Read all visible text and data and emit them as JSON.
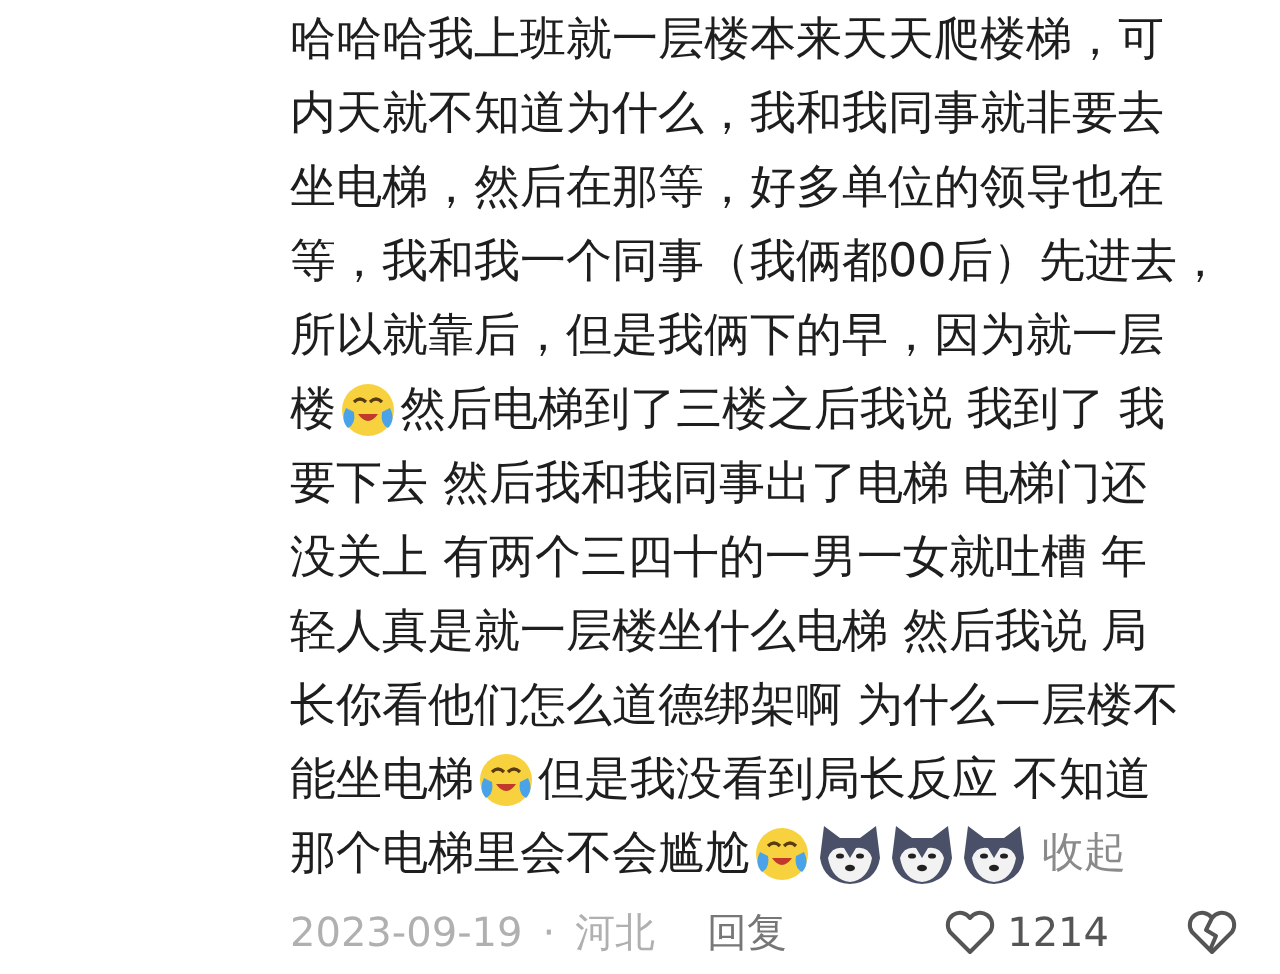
{
  "comment": {
    "lines": [
      {
        "segments": [
          {
            "kind": "text",
            "text": "哈哈哈我上班就一层楼本来天天爬楼梯，可"
          }
        ]
      },
      {
        "segments": [
          {
            "kind": "text",
            "text": "内天就不知道为什么，我和我同事就非要去"
          }
        ]
      },
      {
        "segments": [
          {
            "kind": "text",
            "text": "坐电梯，然后在那等，好多单位的领导也在"
          }
        ]
      },
      {
        "segments": [
          {
            "kind": "text",
            "text": "等，我和我一个同事（我俩都00后）先进去，"
          }
        ]
      },
      {
        "segments": [
          {
            "kind": "text",
            "text": "所以就靠后，但是我俩下的早，因为就一层"
          }
        ]
      },
      {
        "segments": [
          {
            "kind": "text",
            "text": "楼"
          },
          {
            "kind": "tears"
          },
          {
            "kind": "text",
            "text": "然后电梯到了三楼之后我说 我到了 我"
          }
        ]
      },
      {
        "segments": [
          {
            "kind": "text",
            "text": "要下去 然后我和我同事出了电梯 电梯门还"
          }
        ]
      },
      {
        "segments": [
          {
            "kind": "text",
            "text": "没关上 有两个三四十的一男一女就吐槽 年"
          }
        ]
      },
      {
        "segments": [
          {
            "kind": "text",
            "text": "轻人真是就一层楼坐什么电梯 然后我说 局"
          }
        ]
      },
      {
        "segments": [
          {
            "kind": "text",
            "text": "长你看他们怎么道德绑架啊 为什么一层楼不"
          }
        ]
      },
      {
        "segments": [
          {
            "kind": "text",
            "text": "能坐电梯"
          },
          {
            "kind": "tears"
          },
          {
            "kind": "text",
            "text": "但是我没看到局长反应 不知道"
          }
        ]
      },
      {
        "segments": [
          {
            "kind": "text",
            "text": "那个电梯里会不会尴尬"
          },
          {
            "kind": "tears"
          },
          {
            "kind": "dog"
          },
          {
            "kind": "dog"
          },
          {
            "kind": "dog"
          },
          {
            "kind": "link",
            "text": "收起"
          }
        ]
      }
    ]
  },
  "footer": {
    "date": "2023-09-19",
    "separator": "·",
    "location": "河北",
    "reply": "回复",
    "likes": "1214"
  }
}
